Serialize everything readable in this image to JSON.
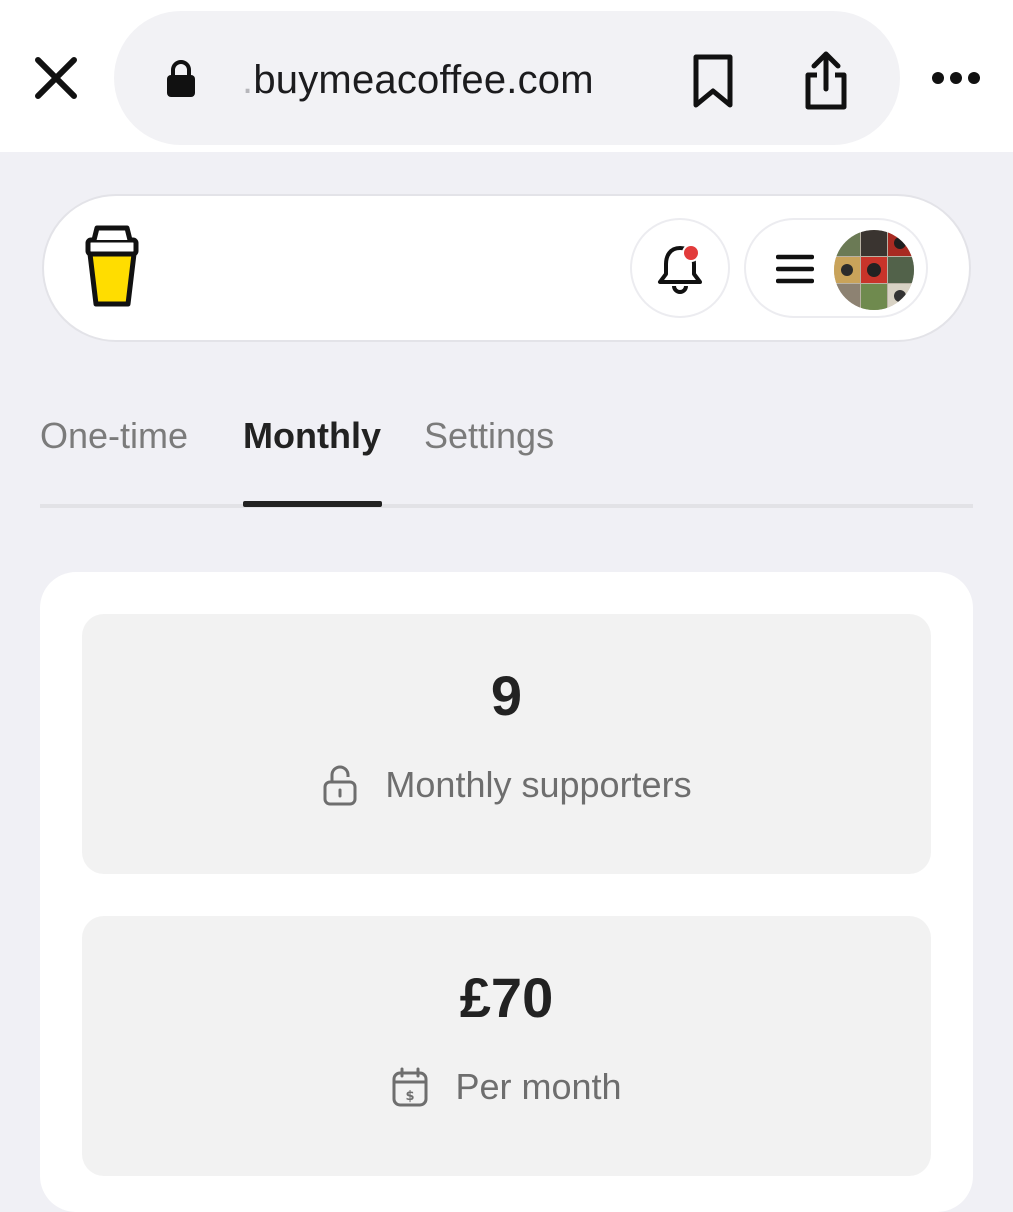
{
  "browser": {
    "url_prefix": ".",
    "url_domain": "buymeacoffee.com",
    "icons": {
      "close": "close-icon",
      "lock": "lock-icon",
      "bookmark": "bookmark-icon",
      "share": "share-icon",
      "more": "more-icon"
    }
  },
  "header": {
    "logo": "buy-me-a-coffee-cup-logo",
    "notification": {
      "icon": "bell-icon",
      "has_unread": true,
      "dot_color": "#e23b3b"
    },
    "menu": {
      "icon": "hamburger-icon",
      "avatar": "avatar"
    }
  },
  "tabs": [
    {
      "label": "One-time",
      "active": false
    },
    {
      "label": "Monthly",
      "active": true
    },
    {
      "label": "Settings",
      "active": false
    }
  ],
  "stats": [
    {
      "value": "9",
      "label": "Monthly supporters",
      "icon": "lock-open-icon"
    },
    {
      "value": "£70",
      "label": "Per month",
      "icon": "calendar-dollar-icon"
    }
  ],
  "colors": {
    "logo_fill": "#ffdd00",
    "page_bg": "#f0f0f5",
    "active_tab": "#222222",
    "inactive_tab": "#7b7b7b"
  }
}
